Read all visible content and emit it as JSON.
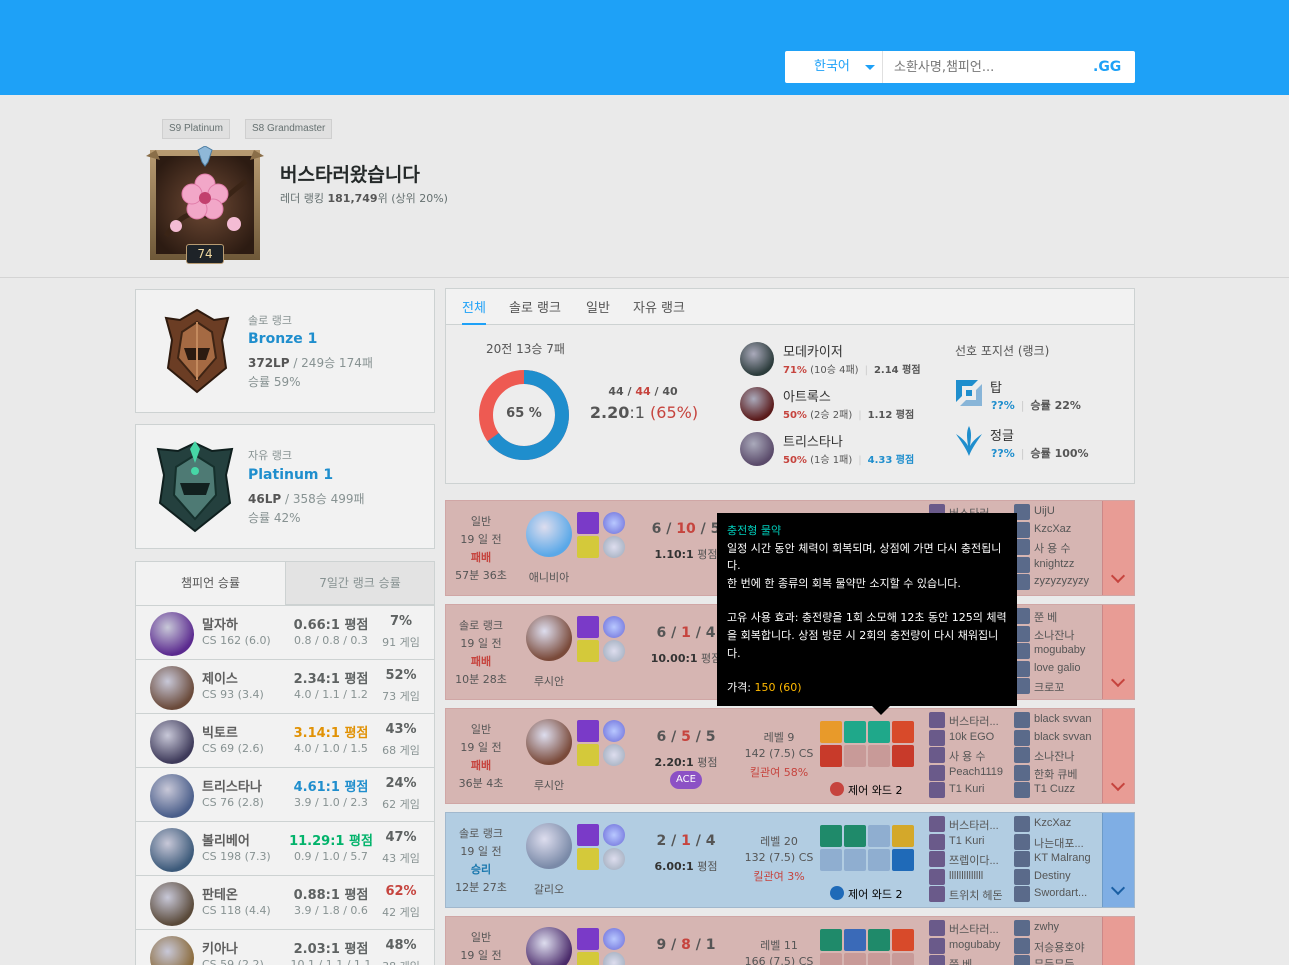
{
  "header": {
    "language": "한국어",
    "search_placeholder": "소환사명,챔피언...",
    "search_button": ".GG"
  },
  "profile": {
    "seasons": [
      "S9 Platinum",
      "S8 Grandmaster"
    ],
    "level": "74",
    "name": "버스타러왔습니다",
    "ladder_label": "레더 랭킹",
    "ladder_rank": "181,749",
    "ladder_suffix": "위 (상위 20%)"
  },
  "ranks": {
    "solo": {
      "type": "솔로 랭크",
      "tier": "Bronze 1",
      "lp": "372LP",
      "record": " / 249승 174패",
      "winrate": "승률 59%"
    },
    "flex": {
      "type": "자유 랭크",
      "tier": "Platinum 1",
      "lp": "46LP",
      "record": " / 358승 499패",
      "winrate": "승률 42%"
    }
  },
  "champ_tabs": [
    "챔피언 승률",
    "7일간 랭크 승률"
  ],
  "champions": [
    {
      "name": "말자하",
      "cs": "CS 162 (6.0)",
      "kda": "0.66:1 평점",
      "detail": "0.8 / 0.8 / 0.3",
      "wr": "7%",
      "games": "91 게임",
      "kda_color": "#5e6262",
      "wr_color": "#5e6262"
    },
    {
      "name": "제이스",
      "cs": "CS 93 (3.4)",
      "kda": "2.34:1 평점",
      "detail": "4.0 / 1.1 / 1.2",
      "wr": "52%",
      "games": "73 게임",
      "kda_color": "#5e6262",
      "wr_color": "#5e6262"
    },
    {
      "name": "빅토르",
      "cs": "CS 69 (2.6)",
      "kda": "3.14:1 평점",
      "detail": "4.0 / 1.0 / 1.5",
      "wr": "43%",
      "games": "68 게임",
      "kda_color": "#e19205",
      "wr_color": "#5e6262"
    },
    {
      "name": "트리스타나",
      "cs": "CS 76 (2.8)",
      "kda": "4.61:1 평점",
      "detail": "3.9 / 1.0 / 2.3",
      "wr": "24%",
      "games": "62 게임",
      "kda_color": "#1f8ecd",
      "wr_color": "#5e6262"
    },
    {
      "name": "볼리베어",
      "cs": "CS 198 (7.3)",
      "kda": "11.29:1 평점",
      "detail": "0.9 / 1.0 / 5.7",
      "wr": "47%",
      "games": "43 게임",
      "kda_color": "#02b36b",
      "wr_color": "#5e6262"
    },
    {
      "name": "판테온",
      "cs": "CS 118 (4.4)",
      "kda": "0.88:1 평점",
      "detail": "3.9 / 1.8 / 0.6",
      "wr": "62%",
      "games": "42 게임",
      "kda_color": "#5e6262",
      "wr_color": "#c6443e"
    },
    {
      "name": "키아나",
      "cs": "CS 59 (2.2)",
      "kda": "2.03:1 평점",
      "detail": "10.1 / 1.1 / 1.1",
      "wr": "48%",
      "games": "38 게임",
      "kda_color": "#5e6262",
      "wr_color": "#5e6262"
    }
  ],
  "summary_tabs": [
    "전체",
    "솔로 랭크",
    "일반",
    "자유 랭크"
  ],
  "summary": {
    "record": "20전 13승 7패",
    "donut_pct": "65 %",
    "donut_win_fraction": 0.65,
    "kills": "44",
    "deaths": "44",
    "assists": "40",
    "ratio": "2.20",
    "ratio_tail": ":1",
    "ratio_pct": " (65%)",
    "top_champs": [
      {
        "name": "모데카이저",
        "wr": "71%",
        "rec": " (10승 4패)",
        "kda": "2.14 평점",
        "kda_color": "#555"
      },
      {
        "name": "아트록스",
        "wr": "50%",
        "rec": " (2승 2패)",
        "kda": "1.12 평점",
        "kda_color": "#555"
      },
      {
        "name": "트리스타나",
        "wr": "50%",
        "rec": " (1승 1패)",
        "kda": "4.33 평점",
        "kda_color": "#1f8ecd"
      }
    ],
    "pos_title": "선호 포지션 (랭크)",
    "positions": [
      {
        "name": "탑",
        "pct": "??%",
        "wr": "승률 22%"
      },
      {
        "name": "정글",
        "pct": "??%",
        "wr": "승률 100%"
      }
    ]
  },
  "games": [
    {
      "type": "일반",
      "ago": "19 일 전",
      "result": "패배",
      "duration": "57분 36초",
      "win": false,
      "champ": "애니비아",
      "k": "6",
      "d": "10",
      "a": "5",
      "ratio": "1.10:1",
      "ratio_label": " 평점",
      "level": "",
      "cs": "",
      "kp": "",
      "ward": "",
      "ace": "",
      "blue": [
        "버스타러...",
        "",
        "",
        "",
        ""
      ],
      "red": [
        "UijU",
        "KzcXaz",
        "사 용 수",
        "knightzz",
        "zyzyzyzyzy"
      ]
    },
    {
      "type": "솔로 랭크",
      "ago": "19 일 전",
      "result": "패배",
      "duration": "10분 28초",
      "win": false,
      "champ": "루시안",
      "k": "6",
      "d": "1",
      "a": "4",
      "ratio": "10.00:1",
      "ratio_label": " 평점",
      "level": "",
      "cs": "",
      "kp": "",
      "ward": "",
      "ace": "",
      "blue": [
        "",
        "",
        "",
        "",
        ""
      ],
      "red": [
        "쭌 베",
        "소나잔나",
        "mogubaby",
        "love galio",
        "크로꼬"
      ]
    },
    {
      "type": "일반",
      "ago": "19 일 전",
      "result": "패배",
      "duration": "36분 4초",
      "win": false,
      "champ": "루시안",
      "k": "6",
      "d": "5",
      "a": "5",
      "ratio": "2.20:1",
      "ratio_label": " 평점",
      "level": "레벨 9",
      "cs": "142 (7.5) CS",
      "kp": "킬관여 58%",
      "ward": "제어 와드 2",
      "ace": "ACE",
      "blue": [
        "버스타러...",
        "10k EGO",
        "사 용 수",
        "Peach1119",
        "T1 Kuri"
      ],
      "red": [
        "black svvan",
        "black svvan",
        "소나잔나",
        "한화 큐베",
        "T1 Cuzz"
      ]
    },
    {
      "type": "솔로 랭크",
      "ago": "19 일 전",
      "result": "승리",
      "duration": "12분 27초",
      "win": true,
      "champ": "갈리오",
      "k": "2",
      "d": "1",
      "a": "4",
      "ratio": "6.00:1",
      "ratio_label": " 평점",
      "level": "레벨 20",
      "cs": "132 (7.5) CS",
      "kp": "킬관여 3%",
      "ward": "제어 와드 2",
      "ace": "",
      "blue": [
        "버스타러...",
        "T1 Kuri",
        "쯔렙이다...",
        "llllllllllllll",
        "트위치 헤돈"
      ],
      "red": [
        "KzcXaz",
        "나는대포...",
        "KT Malrang",
        "Destiny",
        "Swordart..."
      ]
    },
    {
      "type": "일반",
      "ago": "19 일 전",
      "result": "",
      "duration": "",
      "win": false,
      "champ": "",
      "k": "9",
      "d": "8",
      "a": "1",
      "ratio": "",
      "ratio_label": "",
      "level": "레벨 11",
      "cs": "166 (7.5) CS",
      "kp": "",
      "ward": "",
      "ace": "",
      "blue": [
        "버스타러...",
        "mogubaby",
        "쭌 베",
        "",
        ""
      ],
      "red": [
        "zwhy",
        "저승용호야",
        "무등무등",
        "",
        ""
      ]
    }
  ],
  "tooltip": {
    "title": "충전형 물약",
    "body1": "일정 시간 동안 체력이 회복되며, 상점에 가면 다시 충전됩니다.",
    "body2": "한 번에 한 종류의 회복 물약만 소지할 수 있습니다.",
    "body3": "고유 사용 효과: 충전량을 1회 소모해 12초 동안 125의 체력을 회복합니다. 상점 방문 시 2회의 충전량이 다시 채워집니다.",
    "cost_label": "가격: ",
    "cost": "150 (60)"
  },
  "colors": {
    "brand": "#1ea1f7",
    "loss": "#c6443e",
    "tier_blue": "#1f8ecd"
  }
}
